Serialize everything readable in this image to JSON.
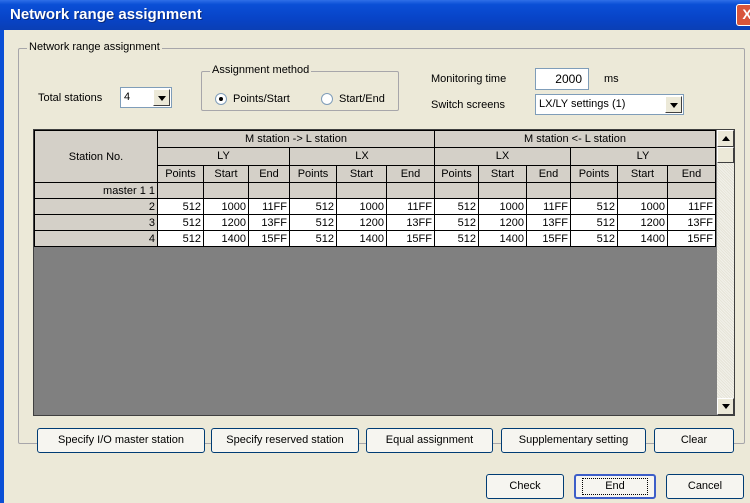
{
  "window": {
    "title": "Network range assignment",
    "close_glyph": "X"
  },
  "group": {
    "legend": "Network range assignment"
  },
  "total_stations": {
    "label": "Total stations",
    "value": "4"
  },
  "assignment_method": {
    "legend": "Assignment method",
    "options": [
      {
        "label": "Points/Start",
        "selected": true
      },
      {
        "label": "Start/End",
        "selected": false
      }
    ]
  },
  "monitoring": {
    "label": "Monitoring time",
    "value": "2000",
    "unit": "ms"
  },
  "switch_screens": {
    "label": "Switch screens",
    "value": "LX/LY settings (1)"
  },
  "grid": {
    "station_header": "Station No.",
    "group_headers": [
      "M station -> L station",
      "M station <- L station"
    ],
    "sub_headers": [
      "LY",
      "LX",
      "LX",
      "LY"
    ],
    "col_headers": [
      "Points",
      "Start",
      "End",
      "Points",
      "Start",
      "End",
      "Points",
      "Start",
      "End",
      "Points",
      "Start",
      "End"
    ],
    "rows": [
      {
        "station": "master 1   1",
        "cells": [
          "",
          "",
          "",
          "",
          "",
          "",
          "",
          "",
          "",
          "",
          "",
          ""
        ]
      },
      {
        "station": "2",
        "cells": [
          "512",
          "1000",
          "11FF",
          "512",
          "1000",
          "11FF",
          "512",
          "1000",
          "11FF",
          "512",
          "1000",
          "11FF"
        ]
      },
      {
        "station": "3",
        "cells": [
          "512",
          "1200",
          "13FF",
          "512",
          "1200",
          "13FF",
          "512",
          "1200",
          "13FF",
          "512",
          "1200",
          "13FF"
        ]
      },
      {
        "station": "4",
        "cells": [
          "512",
          "1400",
          "15FF",
          "512",
          "1400",
          "15FF",
          "512",
          "1400",
          "15FF",
          "512",
          "1400",
          "15FF"
        ]
      }
    ]
  },
  "buttons": {
    "specify_io": "Specify I/O master station",
    "specify_reserved": "Specify reserved station",
    "equal": "Equal assignment",
    "supplementary": "Supplementary setting",
    "clear": "Clear",
    "check": "Check",
    "end": "End",
    "cancel": "Cancel"
  }
}
